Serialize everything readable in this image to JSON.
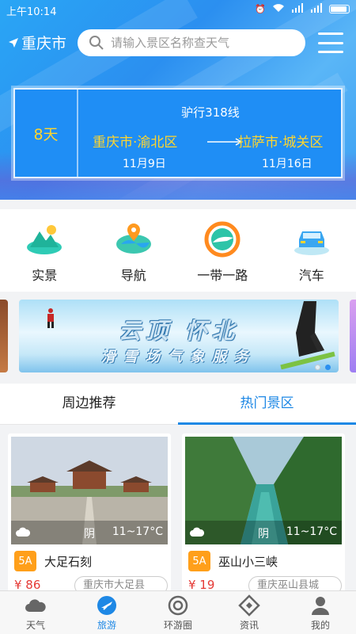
{
  "status_bar": {
    "time": "上午10:14"
  },
  "header": {
    "city": "重庆市",
    "search_placeholder": "请输入景区名称查天气"
  },
  "route": {
    "days": "8天",
    "mode": "驴行318线",
    "from": "重庆市·渝北区",
    "to": "拉萨市·城关区",
    "from_date": "11月9日",
    "to_date": "11月16日"
  },
  "features": [
    {
      "label": "实景",
      "icon": "landscape-icon"
    },
    {
      "label": "导航",
      "icon": "navigation-pin-icon"
    },
    {
      "label": "一带一路",
      "icon": "belt-road-icon"
    },
    {
      "label": "汽车",
      "icon": "car-icon"
    }
  ],
  "banner": {
    "title": "云顶 怀北",
    "subtitle": "滑雪场气象服务"
  },
  "tabs": [
    {
      "label": "周边推荐",
      "active": false
    },
    {
      "label": "热门景区",
      "active": true
    }
  ],
  "scenic_spots": [
    {
      "name": "大足石刻",
      "grade": "5A",
      "weather": "阴",
      "temp": "11~17°C",
      "price": "¥ 86",
      "location": "重庆市大足县"
    },
    {
      "name": "巫山小三峡",
      "grade": "5A",
      "weather": "阴",
      "temp": "11~17°C",
      "price": "¥ 19",
      "location": "重庆巫山县城"
    }
  ],
  "bottom_nav": [
    {
      "label": "天气",
      "active": false
    },
    {
      "label": "旅游",
      "active": true
    },
    {
      "label": "环游圈",
      "active": false
    },
    {
      "label": "资讯",
      "active": false
    },
    {
      "label": "我的",
      "active": false
    }
  ],
  "colors": {
    "accent": "#1e88e5",
    "highlight": "#ffd52e",
    "price": "#e53935",
    "badge": "#ff9f1a"
  }
}
